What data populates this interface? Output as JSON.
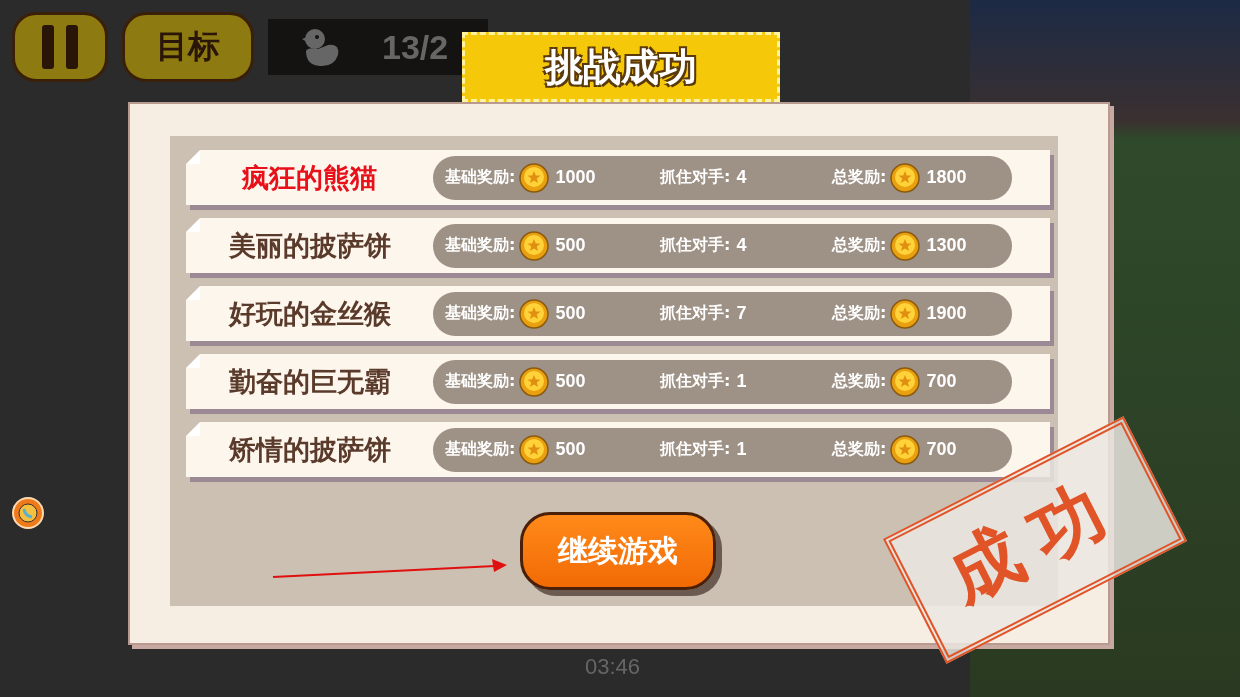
{
  "hud": {
    "target_button": "目标",
    "count": "13/2"
  },
  "dialog": {
    "title": "挑战成功",
    "rows": [
      {
        "name": "疯狂的熊猫",
        "highlighted": true,
        "base_label": "基础奖励:",
        "base": "1000",
        "catch_label": "抓住对手:",
        "catch": "4",
        "total_label": "总奖励:",
        "total": "1800"
      },
      {
        "name": "美丽的披萨饼",
        "highlighted": false,
        "base_label": "基础奖励:",
        "base": "500",
        "catch_label": "抓住对手:",
        "catch": "4",
        "total_label": "总奖励:",
        "total": "1300"
      },
      {
        "name": "好玩的金丝猴",
        "highlighted": false,
        "base_label": "基础奖励:",
        "base": "500",
        "catch_label": "抓住对手:",
        "catch": "7",
        "total_label": "总奖励:",
        "total": "1900"
      },
      {
        "name": "勤奋的巨无霸",
        "highlighted": false,
        "base_label": "基础奖励:",
        "base": "500",
        "catch_label": "抓住对手:",
        "catch": "1",
        "total_label": "总奖励:",
        "total": "700"
      },
      {
        "name": "矫情的披萨饼",
        "highlighted": false,
        "base_label": "基础奖励:",
        "base": "500",
        "catch_label": "抓住对手:",
        "catch": "1",
        "total_label": "总奖励:",
        "total": "700"
      }
    ],
    "continue_button": "继续游戏"
  },
  "stamp": "成功",
  "timer": "03:46"
}
